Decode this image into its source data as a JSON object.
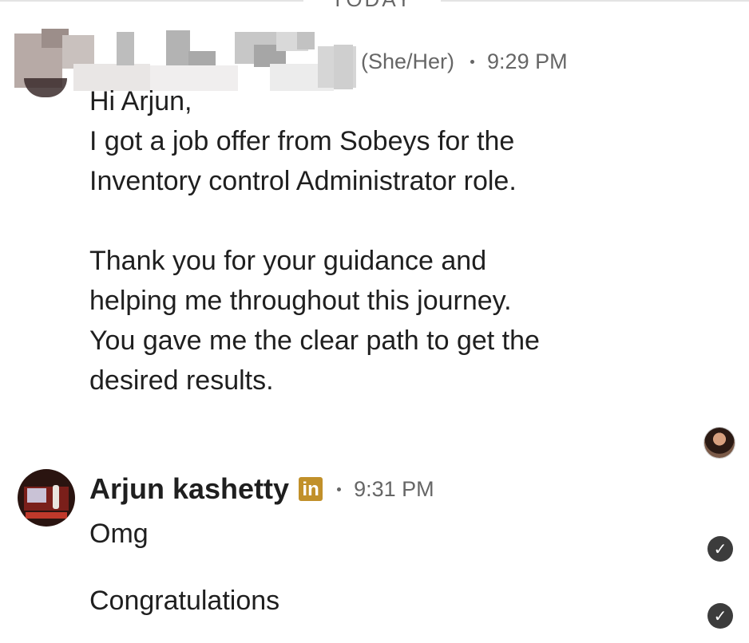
{
  "day_divider": "TODAY",
  "message1": {
    "sender_pronouns": "(She/Her)",
    "time": "9:29 PM",
    "paragraphs": [
      [
        "Hi Arjun,",
        "I got a job offer from Sobeys for the",
        "Inventory control Administrator role."
      ],
      [
        "Thank you for your guidance and",
        "helping me throughout this journey.",
        "You gave me the clear path to get the",
        "desired results."
      ]
    ]
  },
  "message2": {
    "sender_name": "Arjun kashetty",
    "badge": "in",
    "time": "9:31 PM",
    "replies": [
      "Omg",
      "Congratulations"
    ]
  },
  "icons": {
    "check": "check-circle-icon",
    "linkedin": "linkedin-icon"
  },
  "colors": {
    "text": "#1f1f1f",
    "meta": "#666666",
    "linkedin_badge": "#c1902a",
    "check": "#3c3c3c"
  }
}
